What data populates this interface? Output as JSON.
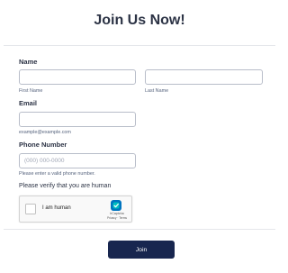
{
  "form": {
    "title": "Join Us Now!",
    "name": {
      "label": "Name",
      "first_name": {
        "value": "",
        "placeholder": "",
        "sublabel": "First Name"
      },
      "last_name": {
        "value": "",
        "placeholder": "",
        "sublabel": "Last Name"
      }
    },
    "email": {
      "label": "Email",
      "value": "",
      "placeholder": "",
      "sublabel": "example@example.com"
    },
    "phone": {
      "label": "Phone Number",
      "value": "",
      "placeholder": "(000) 000-0000",
      "sublabel": "Please enter a valid phone number."
    },
    "verify": {
      "label": "Please verify that you are human",
      "captcha_text": "I am human",
      "captcha_brand": "hCaptcha",
      "captcha_links": "Privacy · Terms",
      "checked": false
    },
    "submit_label": "Join"
  },
  "colors": {
    "text": "#2c3345",
    "sublabel": "#57647e",
    "button_bg": "#18264f",
    "button_text": "#ffffff",
    "border": "#b8bdc9",
    "captcha_accent": "#0074bf"
  },
  "icons": {
    "captcha_logo": "hcaptcha-logo-icon"
  }
}
